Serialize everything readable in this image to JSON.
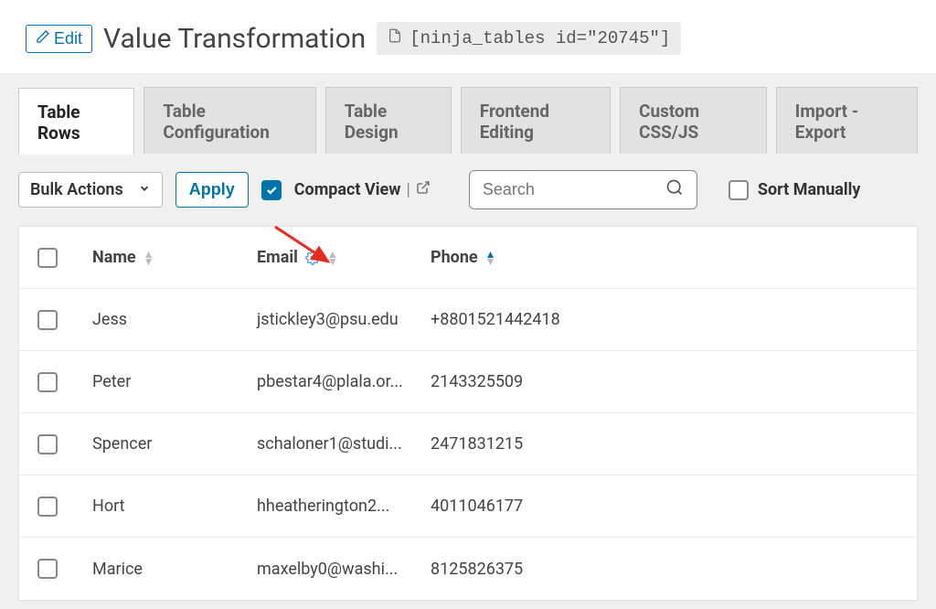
{
  "header": {
    "edit_label": "Edit",
    "title": "Value Transformation",
    "shortcode": "[ninja_tables id=\"20745\"]"
  },
  "tabs": [
    {
      "label": "Table Rows",
      "active": true
    },
    {
      "label": "Table Configuration",
      "active": false
    },
    {
      "label": "Table Design",
      "active": false
    },
    {
      "label": "Frontend Editing",
      "active": false
    },
    {
      "label": "Custom CSS/JS",
      "active": false
    },
    {
      "label": "Import - Export",
      "active": false
    }
  ],
  "toolbar": {
    "bulk_label": "Bulk Actions",
    "apply_label": "Apply",
    "compact_label": "Compact View",
    "search_placeholder": "Search",
    "sort_label": "Sort Manually"
  },
  "columns": {
    "name": "Name",
    "email": "Email",
    "phone": "Phone"
  },
  "rows": [
    {
      "name": "Jess",
      "email": "jstickley3@psu.edu",
      "phone": "+8801521442418"
    },
    {
      "name": "Peter",
      "email": "pbestar4@plala.or...",
      "phone": "2143325509"
    },
    {
      "name": "Spencer",
      "email": "schaloner1@studi...",
      "phone": "2471831215"
    },
    {
      "name": "Hort",
      "email": "hheatherington2...",
      "phone": "4011046177"
    },
    {
      "name": "Marice",
      "email": "maxelby0@washi...",
      "phone": "8125826375"
    }
  ]
}
